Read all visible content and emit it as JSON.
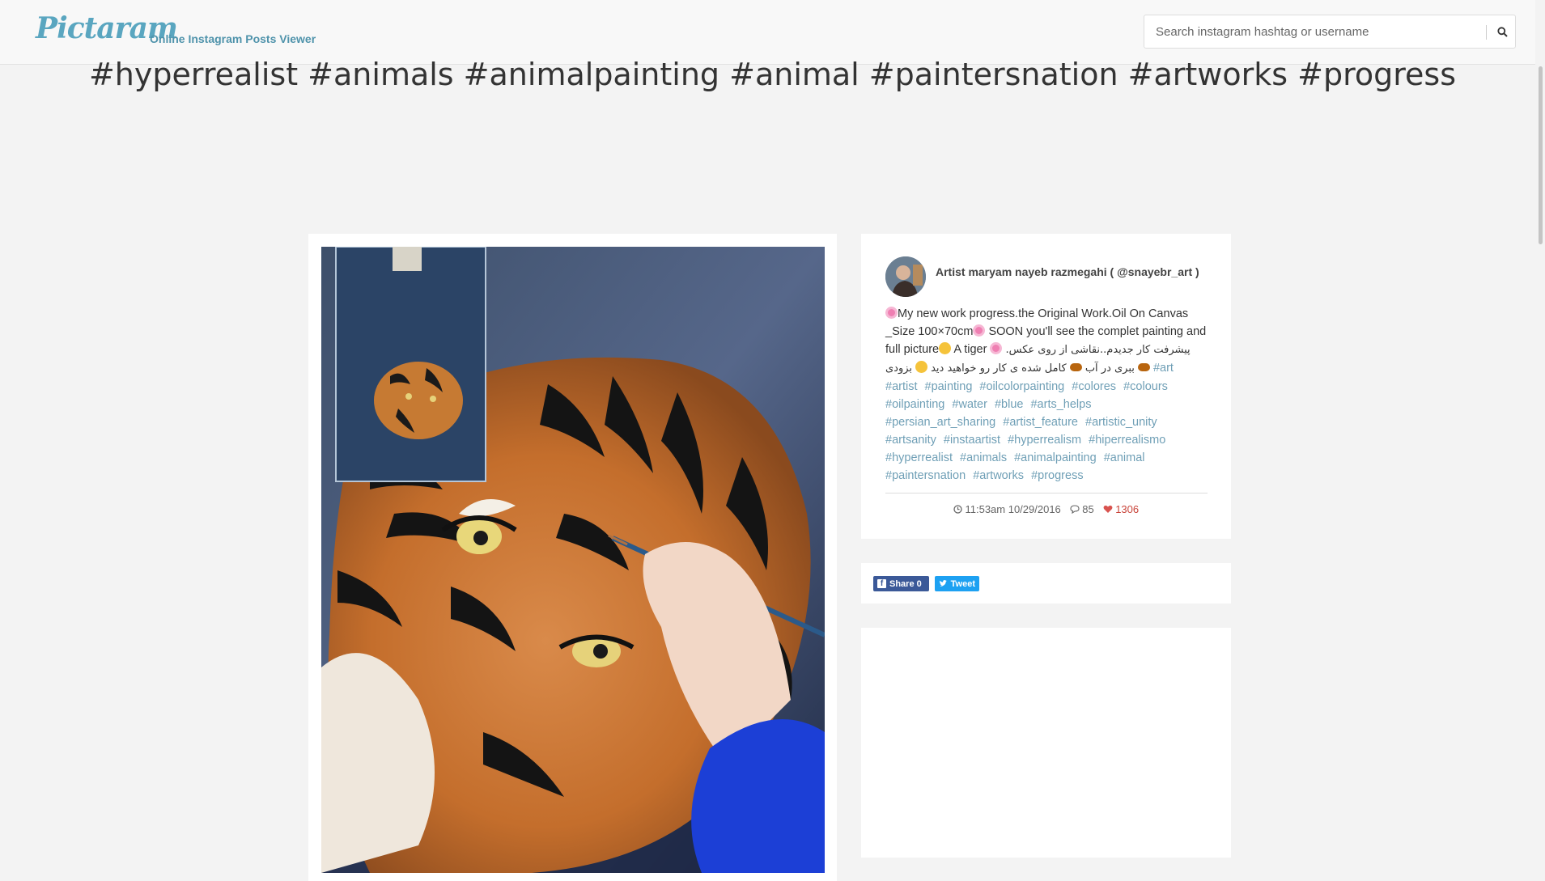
{
  "header": {
    "logo": "Pictaram",
    "tagline": "Online Instagram Posts Viewer",
    "search_placeholder": "Search instagram hashtag or username"
  },
  "page": {
    "title": "#hyperrealist #animals #animalpainting #animal #paintersnation #artworks #progress"
  },
  "post": {
    "author": "Artist maryam nayeb razmegahi ( @snayebr_art )",
    "caption_lead": "My new work progress.the Original Work.Oil On Canvas _Size 100×70cm",
    "caption_mid": " SOON you'll see the complet painting and full picture",
    "caption_tiger": " A tiger ",
    "caption_persian_1": "پیشرفت کار جدیدم..نقاشی از روی عکس. بزودی",
    "caption_persian_2": "کامل شده ی کار رو خواهید دید",
    "caption_persian_3": "ببری در آب",
    "hashtags": [
      "#art",
      "#artist",
      "#painting",
      "#oilcolorpainting",
      "#colores",
      "#colours",
      "#oilpainting",
      "#water",
      "#blue",
      "#arts_helps",
      "#persian_art_sharing",
      "#artist_feature",
      "#artistic_unity",
      "#artsanity",
      "#instaartist",
      "#hyperrealism",
      "#hiperrealismo",
      "#hyperrealist",
      "#animals",
      "#animalpainting",
      "#animal",
      "#paintersnation",
      "#artworks",
      "#progress"
    ],
    "time": "11:53am 10/29/2016",
    "comments": "85",
    "likes": "1306"
  },
  "share": {
    "facebook_label": "Share 0",
    "twitter_label": "Tweet"
  },
  "colors": {
    "brand": "#5aa6c0",
    "hashtag": "#6f9fb6",
    "likes": "#c9443a",
    "facebook": "#3b5998",
    "twitter": "#1da1f2"
  },
  "icons": [
    "search-icon",
    "clock-icon",
    "comment-icon",
    "heart-icon",
    "facebook-icon",
    "twitter-icon"
  ]
}
